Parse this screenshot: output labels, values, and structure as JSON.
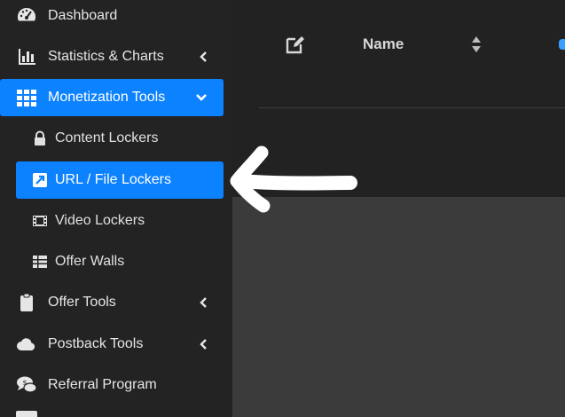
{
  "sidebar": {
    "items": [
      {
        "label": "Dashboard",
        "icon": "dashboard-icon"
      },
      {
        "label": "Statistics & Charts",
        "icon": "bar-chart-icon",
        "caret": "left"
      },
      {
        "label": "Monetization Tools",
        "icon": "grid-icon",
        "caret": "down",
        "active": true
      },
      {
        "label": "Offer Tools",
        "icon": "clipboard-icon",
        "caret": "left"
      },
      {
        "label": "Postback Tools",
        "icon": "cloud-icon",
        "caret": "left"
      },
      {
        "label": "Referral Program",
        "icon": "chat-dollar-icon"
      }
    ],
    "subitems": [
      {
        "label": "Content Lockers",
        "icon": "lock-icon"
      },
      {
        "label": "URL / File Lockers",
        "icon": "external-link-icon",
        "selected": true
      },
      {
        "label": "Video Lockers",
        "icon": "film-icon"
      },
      {
        "label": "Offer Walls",
        "icon": "table-icon"
      }
    ]
  },
  "table": {
    "columns": [
      {
        "label": "Name",
        "sort_icon": "sort-icon"
      }
    ]
  },
  "colors": {
    "accent": "#0d82ff",
    "sidebar_bg": "#232323",
    "annotation_arrow": "#ffffff"
  }
}
